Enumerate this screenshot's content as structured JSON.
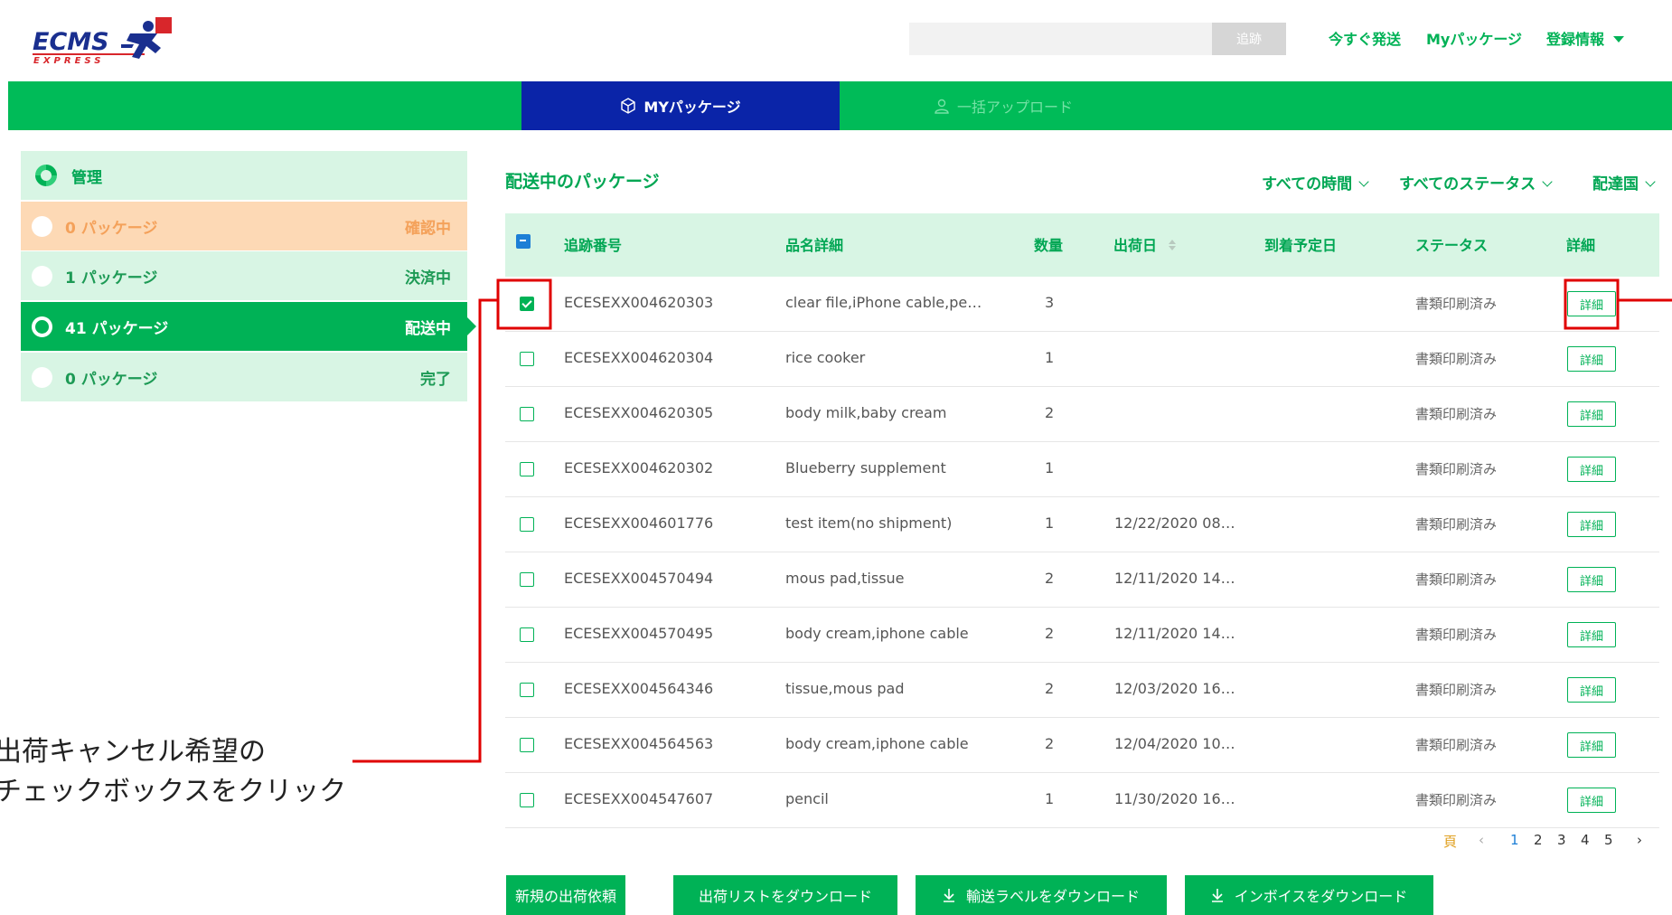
{
  "header": {
    "logo_text": "ECMS",
    "logo_sub": "EXPRESS",
    "search_placeholder": "",
    "search_button": "追跡",
    "links": [
      "今すぐ発送",
      "Myパッケージ",
      "登録情報"
    ]
  },
  "nav": {
    "tabs": [
      {
        "label": "MYパッケージ",
        "icon": "package-icon",
        "active": true
      },
      {
        "label": "一括アップロード",
        "icon": "user-icon",
        "active": false
      }
    ]
  },
  "sidebar": {
    "title": "管理",
    "items": [
      {
        "label": "0 パッケージ",
        "status": "確認中"
      },
      {
        "label": "1 パッケージ",
        "status": "決済中"
      },
      {
        "label": "41 パッケージ",
        "status": "配送中"
      },
      {
        "label": "0 パッケージ",
        "status": "完了"
      }
    ]
  },
  "main": {
    "title": "配送中のパッケージ",
    "filters": [
      "すべての時間",
      "すべてのステータス",
      "配達国"
    ],
    "columns": [
      "追跡番号",
      "品名詳細",
      "数量",
      "出荷日",
      "到着予定日",
      "ステータス",
      "詳細"
    ],
    "rows": [
      {
        "tracking": "ECESEXX004620303",
        "item": "clear file,iPhone cable,pe…",
        "qty": "3",
        "ship": "",
        "eta": "",
        "status": "書類印刷済み",
        "detail": "詳細",
        "checked": true
      },
      {
        "tracking": "ECESEXX004620304",
        "item": "rice cooker",
        "qty": "1",
        "ship": "",
        "eta": "",
        "status": "書類印刷済み",
        "detail": "詳細",
        "checked": false
      },
      {
        "tracking": "ECESEXX004620305",
        "item": "body milk,baby cream",
        "qty": "2",
        "ship": "",
        "eta": "",
        "status": "書類印刷済み",
        "detail": "詳細",
        "checked": false
      },
      {
        "tracking": "ECESEXX004620302",
        "item": "Blueberry supplement",
        "qty": "1",
        "ship": "",
        "eta": "",
        "status": "書類印刷済み",
        "detail": "詳細",
        "checked": false
      },
      {
        "tracking": "ECESEXX004601776",
        "item": "test item(no shipment)",
        "qty": "1",
        "ship": "12/22/2020 08…",
        "eta": "",
        "status": "書類印刷済み",
        "detail": "詳細",
        "checked": false
      },
      {
        "tracking": "ECESEXX004570494",
        "item": "mous pad,tissue",
        "qty": "2",
        "ship": "12/11/2020 14…",
        "eta": "",
        "status": "書類印刷済み",
        "detail": "詳細",
        "checked": false
      },
      {
        "tracking": "ECESEXX004570495",
        "item": "body cream,iphone cable",
        "qty": "2",
        "ship": "12/11/2020 14…",
        "eta": "",
        "status": "書類印刷済み",
        "detail": "詳細",
        "checked": false
      },
      {
        "tracking": "ECESEXX004564346",
        "item": "tissue,mous pad",
        "qty": "2",
        "ship": "12/03/2020 16…",
        "eta": "",
        "status": "書類印刷済み",
        "detail": "詳細",
        "checked": false
      },
      {
        "tracking": "ECESEXX004564563",
        "item": "body cream,iphone cable",
        "qty": "2",
        "ship": "12/04/2020 10…",
        "eta": "",
        "status": "書類印刷済み",
        "detail": "詳細",
        "checked": false
      },
      {
        "tracking": "ECESEXX004547607",
        "item": "pencil",
        "qty": "1",
        "ship": "11/30/2020 16…",
        "eta": "",
        "status": "書類印刷済み",
        "detail": "詳細",
        "checked": false
      }
    ]
  },
  "pagination": {
    "label": "頁",
    "prev": "‹",
    "pages": [
      "1",
      "2",
      "3",
      "4",
      "5"
    ],
    "next": "›",
    "current": "1"
  },
  "actions": [
    "新規の出荷依頼",
    "出荷リストをダウンロード",
    "輸送ラベルをダウンロード",
    "インボイスをダウンロード"
  ],
  "annotation": {
    "line1": "出荷キャンセル希望の",
    "line2": "チェックボックスをクリック"
  },
  "colors": {
    "brand_green": "#00b256",
    "nav_green": "#00bb58",
    "active_tab": "#0a24a8",
    "highlight_red": "#e00000"
  }
}
